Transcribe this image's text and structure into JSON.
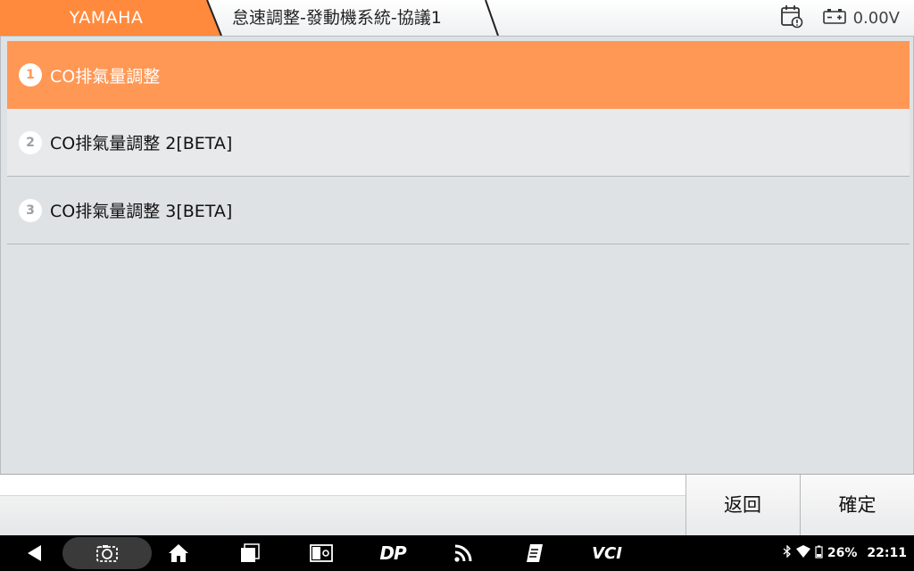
{
  "header": {
    "brand": "YAMAHA",
    "path": "怠速調整-發動機系統-協議1",
    "voltage": "0.00V",
    "brand_color": "#ff8a3d"
  },
  "menu": {
    "items": [
      {
        "number": "1",
        "label": "CO排氣量調整",
        "selected": true
      },
      {
        "number": "2",
        "label": "CO排氣量調整 2[BETA]",
        "selected": false
      },
      {
        "number": "3",
        "label": "CO排氣量調整 3[BETA]",
        "selected": false
      }
    ],
    "selected_color": "#ff9755"
  },
  "actions": {
    "back_label": "返回",
    "confirm_label": "確定"
  },
  "navbar": {
    "icons": [
      "back-icon",
      "screenshot-icon",
      "home-icon",
      "recents-icon",
      "media-icon",
      "dp-icon",
      "rss-icon",
      "notes-icon",
      "vci-icon"
    ],
    "dp_text": "DP",
    "vci_text": "VCI",
    "battery_percent": "26%",
    "time": "22:11"
  }
}
